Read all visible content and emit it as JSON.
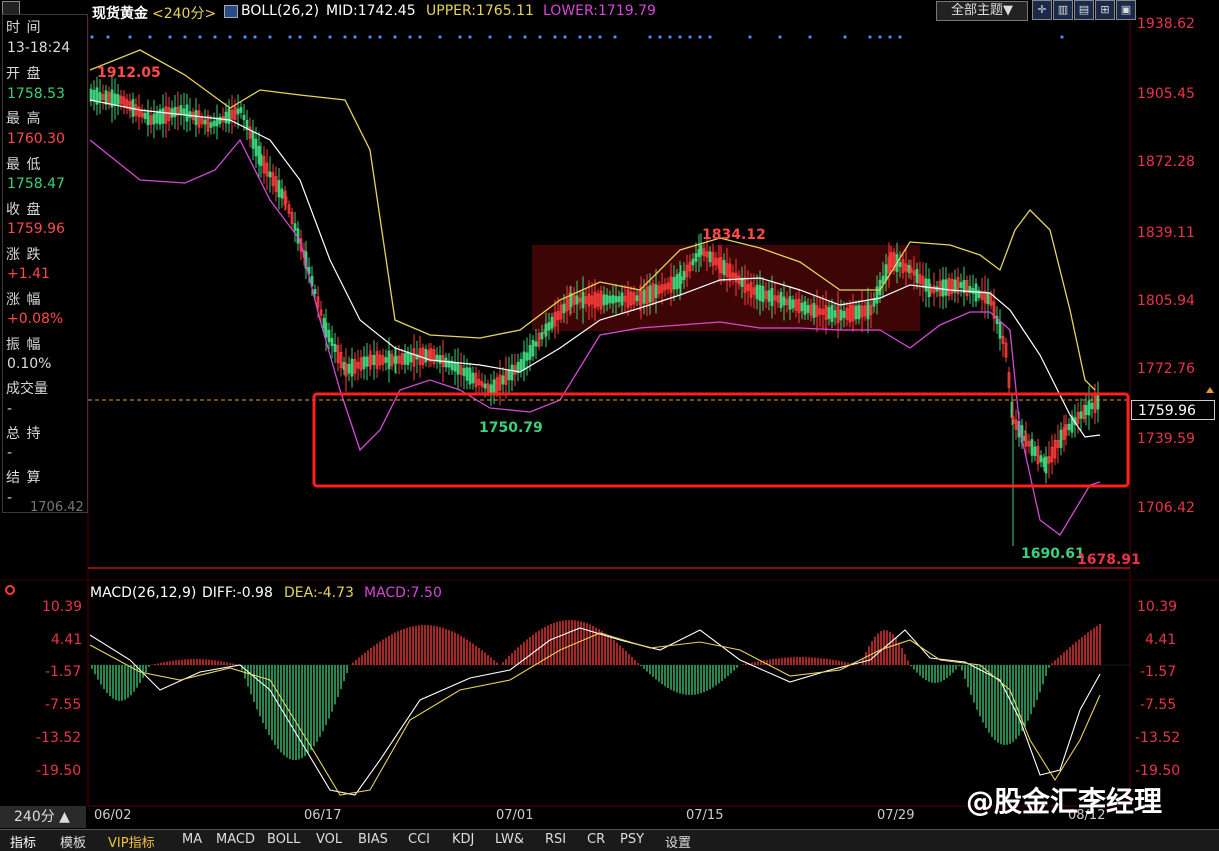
{
  "header": {
    "symbol": "现货黄金",
    "period_tag": "<240分>",
    "indicator": "BOLL(26,2)",
    "mid": "MID:1742.45",
    "upper": "UPPER:1765.11",
    "lower": "LOWER:1719.79",
    "theme_button": "全部主题▼"
  },
  "info_panel": {
    "time_label": "时 间",
    "time_value": "13-18:24",
    "open_label": "开 盘",
    "open_value": "1758.53",
    "high_label": "最 高",
    "high_value": "1760.30",
    "low_label": "最 低",
    "low_value": "1758.47",
    "close_label": "收 盘",
    "close_value": "1759.96",
    "change_label": "涨 跌",
    "change_value": "+1.41",
    "pct_label": "涨 幅",
    "pct_value": "+0.08%",
    "amp_label": "振 幅",
    "amp_value": "0.10%",
    "vol_label": "成交量",
    "vol_value": "-",
    "oi_label": "总 持",
    "oi_value": "-",
    "settle_label": "结 算",
    "settle_value": "-",
    "hidden_value": "1706.42"
  },
  "price_axis": [
    "1938.62",
    "1905.45",
    "1872.28",
    "1839.11",
    "1805.94",
    "1772.76",
    "1739.59",
    "1706.42"
  ],
  "current_price": "1759.96",
  "annotations": {
    "high_start": "1912.05",
    "peak": "1834.12",
    "trough_mid": "1750.79",
    "trough_low": "1690.61",
    "axis_low": "1678.91"
  },
  "macd_header": {
    "name": "MACD(26,12,9)",
    "diff": "DIFF:-0.98",
    "dea": "DEA:-4.73",
    "macd": "MACD:7.50"
  },
  "macd_axis": [
    "10.39",
    "4.41",
    "-1.57",
    "-7.55",
    "-13.52",
    "-19.50"
  ],
  "date_axis": [
    "06/02",
    "06/17",
    "07/01",
    "07/15",
    "07/29",
    "08/12"
  ],
  "period_selector": "240分 ▲",
  "watermark": "@股金汇李经理",
  "tabs": [
    "指标",
    "模板",
    "VIP指标",
    "MA",
    "MACD",
    "BOLL",
    "VOL",
    "BIAS",
    "CCI",
    "KDJ",
    "LW&",
    "RSI",
    "CR",
    "PSY",
    "设置"
  ],
  "colors": {
    "up": "#ff3b3b",
    "down": "#3bd17a",
    "mid": "#ffffff",
    "upper": "#e6d35a",
    "lower": "#d44ad4",
    "axis": "#e8344a",
    "highlight_box": "#ff2020"
  },
  "chart_data": {
    "type": "line",
    "title": "现货黄金 240分",
    "x": [
      "06/02",
      "06/17",
      "07/01",
      "07/15",
      "07/29",
      "08/12"
    ],
    "series": [
      {
        "name": "MID",
        "values": [
          1905,
          1800,
          1760,
          1805,
          1810,
          1742
        ]
      },
      {
        "name": "UPPER",
        "values": [
          1925,
          1930,
          1785,
          1830,
          1835,
          1765
        ]
      },
      {
        "name": "LOWER",
        "values": [
          1875,
          1740,
          1750,
          1790,
          1795,
          1720
        ]
      }
    ],
    "ylim": [
      1678.91,
      1938.62
    ]
  }
}
